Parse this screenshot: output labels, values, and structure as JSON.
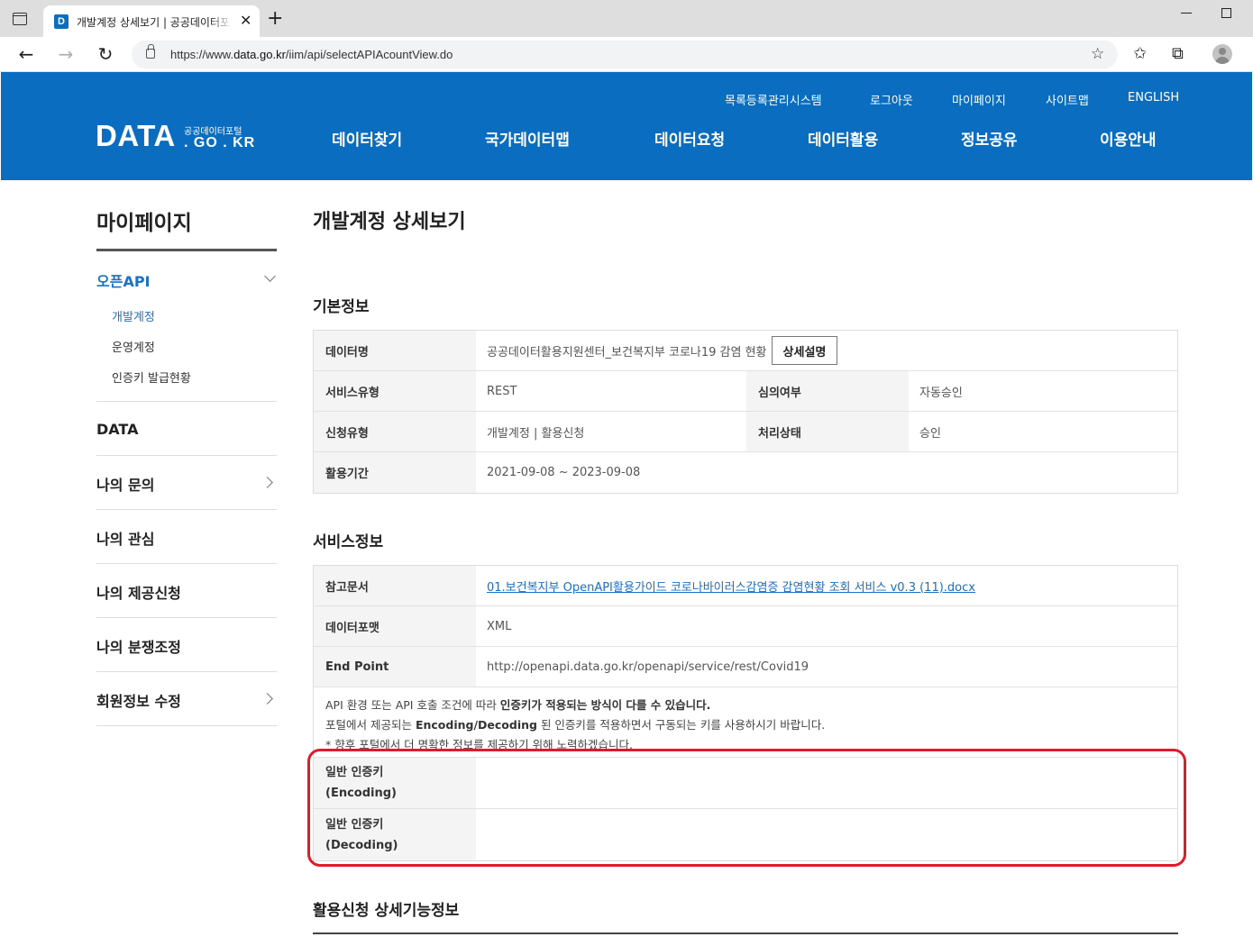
{
  "browser": {
    "tab_title": "개발계정 상세보기 | 공공데이터포털",
    "favicon_letter": "D",
    "url_prefix": "https://www.",
    "url_host": "data.go.kr",
    "url_path": "/iim/api/selectAPIAcountView.do"
  },
  "header": {
    "logo_main": "DATA",
    "logo_sub": "공공데이터포털",
    "logo_domain": ". GO . KR",
    "util_links": [
      "목록등록관리시스템",
      "로그아웃",
      "마이페이지",
      "사이트맵",
      "ENGLISH"
    ],
    "gnb": [
      "데이터찾기",
      "국가데이터맵",
      "데이터요청",
      "데이터활용",
      "정보공유",
      "이용안내"
    ]
  },
  "sidebar": {
    "title": "마이페이지",
    "open_api": "오픈API",
    "sub_items": [
      "개발계정",
      "운영계정",
      "인증키 발급현황"
    ],
    "data": "DATA",
    "items": [
      "나의 문의",
      "나의 관심",
      "나의 제공신청",
      "나의 분쟁조정",
      "회원정보 수정"
    ]
  },
  "main": {
    "page_title": "개발계정 상세보기",
    "basic_section": "기본정보",
    "basic": {
      "data_name_label": "데이터명",
      "data_name_value": "공공데이터활용지원센터_보건복지부 코로나19 감염 현황",
      "detail_button": "상세설명",
      "service_type_label": "서비스유형",
      "service_type_value": "REST",
      "review_label": "심의여부",
      "review_value": "자동승인",
      "apply_type_label": "신청유형",
      "apply_type_value": "개발계정 | 활용신청",
      "status_label": "처리상태",
      "status_value": "승인",
      "period_label": "활용기간",
      "period_value": "2021-09-08 ~ 2023-09-08"
    },
    "service_section": "서비스정보",
    "service": {
      "ref_doc_label": "참고문서",
      "ref_doc_value": "01.보건복지부 OpenAPI활용가이드 코로나바이러스감염증 감염현황 조회 서비스 v0.3 (11).docx",
      "format_label": "데이터포맷",
      "format_value": "XML",
      "endpoint_label": "End Point",
      "endpoint_value": "http://openapi.data.go.kr/openapi/service/rest/Covid19",
      "notice_1a": "API 환경 또는 API 호출 조건에 따라 ",
      "notice_1b": "인증키가 적용되는 방식이 다를 수 있습니다.",
      "notice_2a": "포털에서 제공되는 ",
      "notice_2b": "Encoding/Decoding",
      "notice_2c": " 된 인증키를 적용하면서 구동되는 키를 사용하시기 바랍니다.",
      "notice_3": "* 향후 포털에서 더 명확한 정보를 제공하기 위해 노력하겠습니다.",
      "key_enc_label_1": "일반 인증키",
      "key_enc_label_2": "(Encoding)",
      "key_enc_value": "",
      "key_dec_label_1": "일반 인증키",
      "key_dec_label_2": "(Decoding)",
      "key_dec_value": ""
    },
    "detail_section": "활용신청 상세기능정보"
  },
  "colors": {
    "brand_blue": "#0b6dbf",
    "active_link": "#1a73c8",
    "highlight_red": "#e0192c"
  },
  "icons": [
    "tab-actions-icon",
    "close-icon",
    "plus-icon",
    "back-icon",
    "forward-icon",
    "refresh-icon",
    "lock-icon",
    "add-favorite-icon",
    "favorites-icon",
    "collections-icon",
    "profile-icon",
    "chevron-down-icon",
    "chevron-right-icon"
  ]
}
